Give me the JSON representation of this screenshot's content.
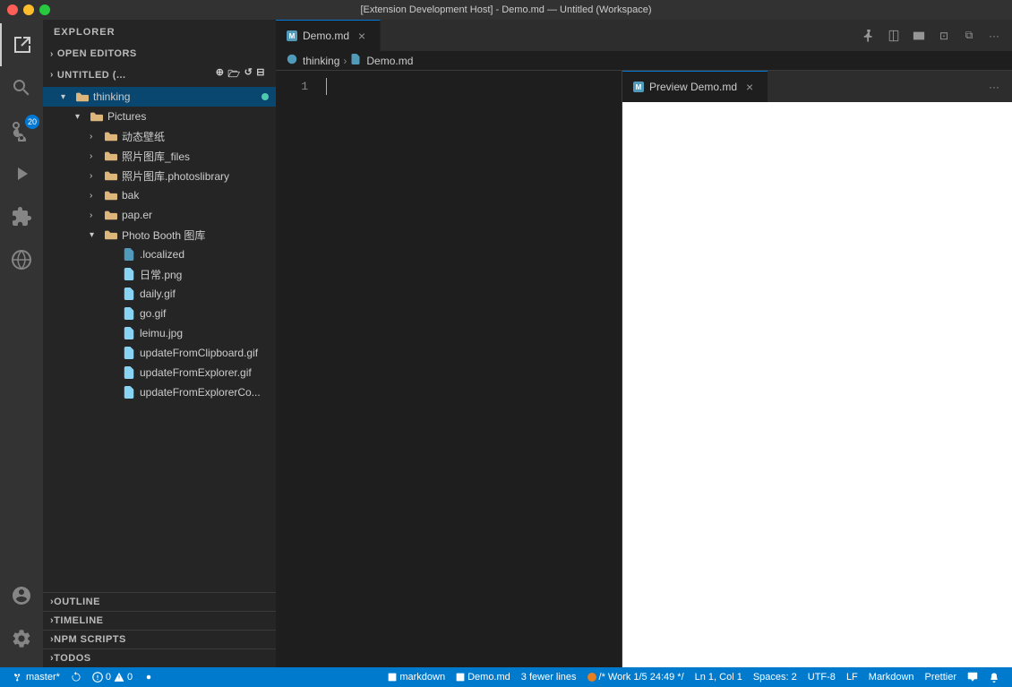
{
  "titlebar": {
    "title": "[Extension Development Host] - Demo.md — Untitled (Workspace)"
  },
  "activitybar": {
    "items": [
      {
        "name": "explorer",
        "label": "Explorer",
        "active": true
      },
      {
        "name": "search",
        "label": "Search"
      },
      {
        "name": "source-control",
        "label": "Source Control",
        "badge": "20"
      },
      {
        "name": "run",
        "label": "Run and Debug"
      },
      {
        "name": "extensions",
        "label": "Extensions"
      },
      {
        "name": "remote-explorer",
        "label": "Remote Explorer"
      }
    ],
    "bottom": [
      {
        "name": "accounts",
        "label": "Accounts"
      },
      {
        "name": "settings",
        "label": "Settings"
      }
    ]
  },
  "sidebar": {
    "title": "EXPLORER",
    "sections": {
      "open_editors": "OPEN EDITORS",
      "untitled": "UNTITLED (...",
      "outline": "OUTLINE",
      "timeline": "TIMELINE",
      "npm_scripts": "NPM SCRIPTS",
      "todos": "TODOS"
    },
    "tree": [
      {
        "id": "thinking",
        "label": "thinking",
        "type": "folder-open",
        "level": 1,
        "active": true,
        "dot": true
      },
      {
        "id": "pictures",
        "label": "Pictures",
        "type": "folder",
        "level": 2
      },
      {
        "id": "donghua",
        "label": "动态壁纸",
        "type": "folder",
        "level": 3
      },
      {
        "id": "photos_files",
        "label": "照片图库_files",
        "type": "folder",
        "level": 3
      },
      {
        "id": "photos_library",
        "label": "照片图库.photoslibrary",
        "type": "folder",
        "level": 3
      },
      {
        "id": "bak",
        "label": "bak",
        "type": "folder",
        "level": 3
      },
      {
        "id": "paper",
        "label": "pap.er",
        "type": "folder",
        "level": 3
      },
      {
        "id": "photobooth",
        "label": "Photo Booth 图库",
        "type": "folder",
        "level": 3
      },
      {
        "id": "localized",
        "label": ".localized",
        "type": "file",
        "level": 4
      },
      {
        "id": "richang",
        "label": "日常.png",
        "type": "image",
        "level": 4
      },
      {
        "id": "daily",
        "label": "daily.gif",
        "type": "gif",
        "level": 4
      },
      {
        "id": "go",
        "label": "go.gif",
        "type": "gif",
        "level": 4
      },
      {
        "id": "leimu",
        "label": "leimu.jpg",
        "type": "jpg",
        "level": 4
      },
      {
        "id": "update_clipboard",
        "label": "updateFromClipboard.gif",
        "type": "gif",
        "level": 4
      },
      {
        "id": "update_explorer",
        "label": "updateFromExplorer.gif",
        "type": "gif",
        "level": 4
      },
      {
        "id": "update_explorerco",
        "label": "updateFromExplorerCo...",
        "type": "gif",
        "level": 4
      }
    ]
  },
  "editor": {
    "tabs": [
      {
        "id": "demo-md",
        "label": "Demo.md",
        "active": true,
        "icon": "md"
      },
      {
        "id": "preview",
        "label": "Preview Demo.md",
        "active": true,
        "panel": "preview"
      }
    ],
    "breadcrumb": {
      "parts": [
        "thinking",
        "Demo.md"
      ]
    },
    "lines": [
      {
        "num": 1,
        "content": ""
      }
    ],
    "actions": [
      "pin",
      "split",
      "split-down",
      "close-others",
      "split-editor",
      "more"
    ]
  },
  "statusbar": {
    "left": [
      {
        "id": "branch",
        "label": "master*"
      },
      {
        "id": "sync",
        "label": ""
      },
      {
        "id": "errors",
        "label": "0"
      },
      {
        "id": "warnings",
        "label": "0"
      },
      {
        "id": "info",
        "label": ""
      }
    ],
    "right": [
      {
        "id": "lint",
        "label": "markdown"
      },
      {
        "id": "demo",
        "label": "Demo.md"
      },
      {
        "id": "lines",
        "label": "3 fewer lines"
      },
      {
        "id": "circle",
        "label": ""
      },
      {
        "id": "work",
        "label": "Work"
      },
      {
        "id": "position",
        "label": "1/5  24:49 */"
      },
      {
        "id": "ln-col",
        "label": "Ln 1, Col 1"
      },
      {
        "id": "spaces",
        "label": "Spaces: 2"
      },
      {
        "id": "encoding",
        "label": "UTF-8"
      },
      {
        "id": "eol",
        "label": "LF"
      },
      {
        "id": "language",
        "label": "Markdown"
      },
      {
        "id": "prettier",
        "label": "Prettier"
      },
      {
        "id": "notify",
        "label": ""
      },
      {
        "id": "bell",
        "label": ""
      }
    ]
  }
}
